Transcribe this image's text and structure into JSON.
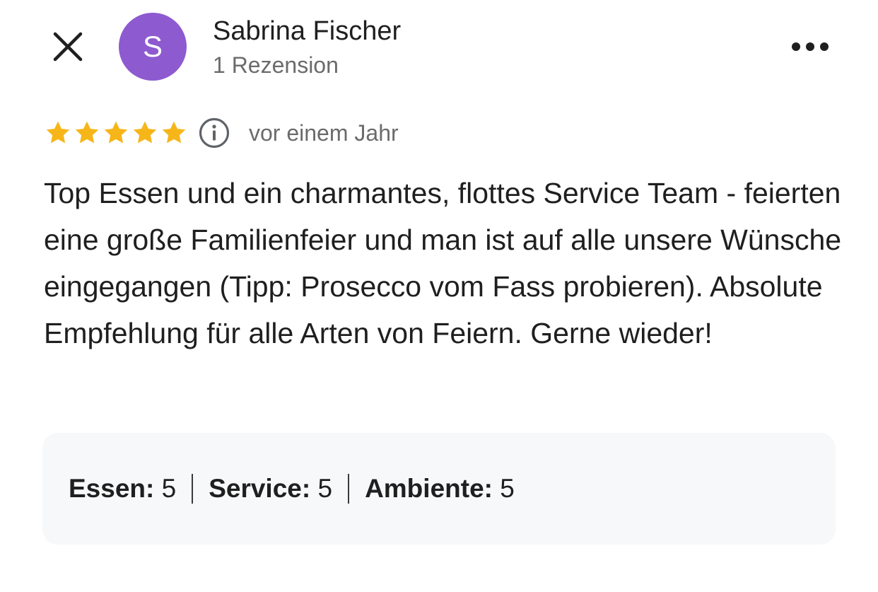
{
  "header": {
    "close_icon": "close-icon",
    "avatar_letter": "S",
    "avatar_color": "#8e5ad0",
    "reviewer_name": "Sabrina Fischer",
    "reviewer_meta": "1 Rezension",
    "more_icon": "more-horizontal-icon"
  },
  "review": {
    "stars": 5,
    "max_stars": 5,
    "star_color": "#f6b619",
    "info_icon": "info-icon",
    "date": "vor einem Jahr",
    "text": "Top Essen und ein charmantes, flottes Service Team - feierten eine große Familienfeier und man ist auf alle unsere Wünsche eingegangen (Tipp: Prosecco vom Fass probieren). Absolute Empfehlung für alle Arten von Feiern. Gerne wieder!"
  },
  "ratings": {
    "items": [
      {
        "label": "Essen:",
        "value": "5"
      },
      {
        "label": "Service:",
        "value": "5"
      },
      {
        "label": "Ambiente:",
        "value": "5"
      }
    ]
  }
}
